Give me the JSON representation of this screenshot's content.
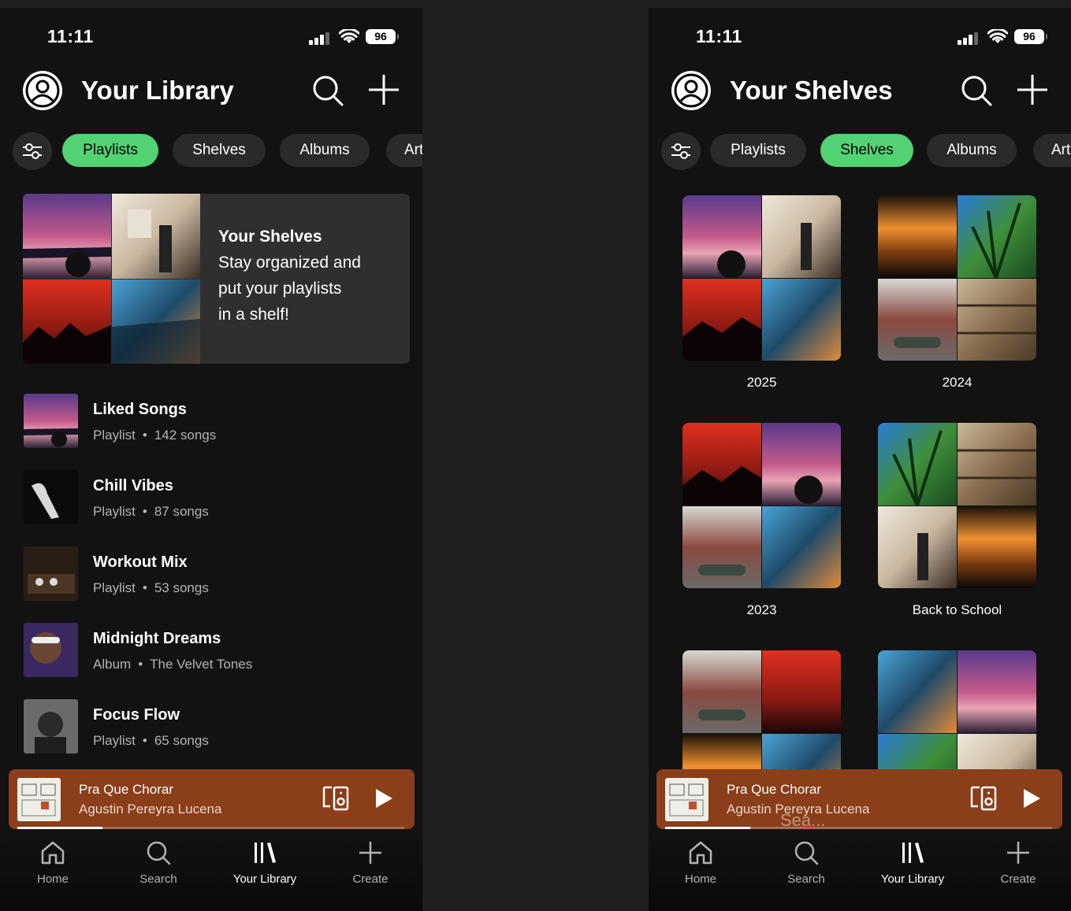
{
  "colors": {
    "accent": "#52d273",
    "background": "#121212",
    "miniplayer": "#8a3e19"
  },
  "left": {
    "status": {
      "time": "11:11",
      "battery": "96"
    },
    "header": {
      "title": "Your Library"
    },
    "filters": [
      "Playlists",
      "Shelves",
      "Albums",
      "Art"
    ],
    "banner": {
      "title": "Your Shelves",
      "line1": "Stay organized and",
      "line2": "put your playlists",
      "line3": "in a shelf!"
    },
    "items": [
      {
        "name": "Liked Songs",
        "type": "Playlist",
        "detail": "142 songs"
      },
      {
        "name": "Chill Vibes",
        "type": "Playlist",
        "detail": "87 songs"
      },
      {
        "name": "Workout Mix",
        "type": "Playlist",
        "detail": "53 songs"
      },
      {
        "name": "Midnight Dreams",
        "type": "Album",
        "detail": "The Velvet Tones"
      },
      {
        "name": "Focus Flow",
        "type": "Playlist",
        "detail": "65 songs"
      }
    ],
    "player": {
      "track": "Pra Que Chorar",
      "artist": "Agustin Pereyra Lucena",
      "progress": 0.22
    },
    "tabs": [
      "Home",
      "Search",
      "Your Library",
      "Create"
    ]
  },
  "right": {
    "status": {
      "time": "11:11",
      "battery": "96"
    },
    "header": {
      "title": "Your Shelves"
    },
    "filters": [
      "Playlists",
      "Shelves",
      "Albums",
      "Art"
    ],
    "shelves": [
      "2025",
      "2024",
      "2023",
      "Back to School"
    ],
    "player": {
      "track": "Pra Que Chorar",
      "artist": "Agustin Pereyra Lucena",
      "progress": 0.22
    },
    "ghost": "Sea...",
    "tabs": [
      "Home",
      "Search",
      "Your Library",
      "Create"
    ]
  }
}
